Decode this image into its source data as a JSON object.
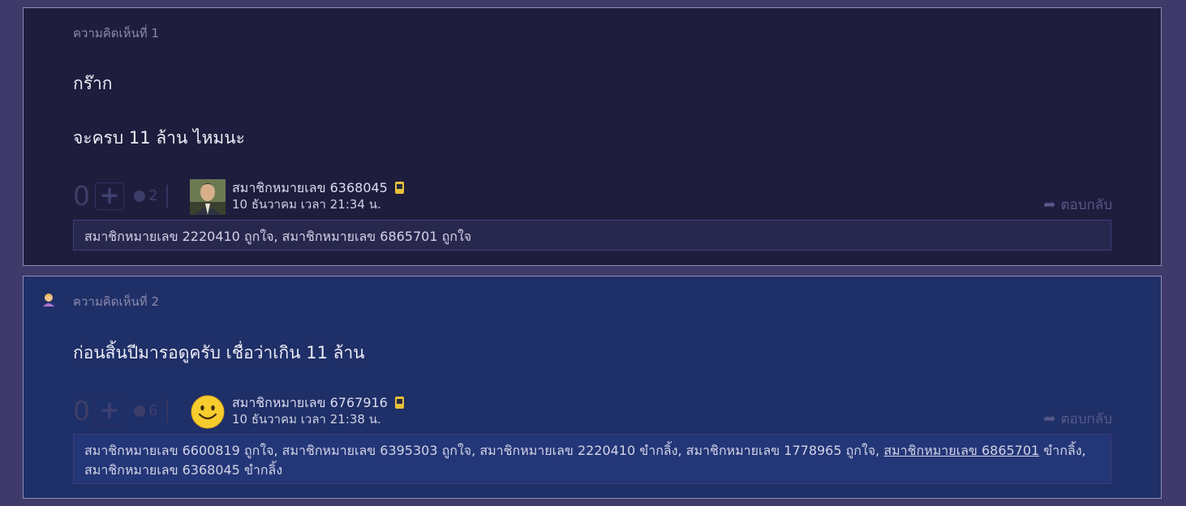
{
  "comments": [
    {
      "number_label": "ความคิดเห็นที่ 1",
      "lines": [
        "กร๊าก",
        "จะครบ 11 ล้าน ไหมนะ"
      ],
      "vote_count": "0",
      "emotion_count": "2",
      "username": "สมาชิกหมายเลข 6368045",
      "date": "10 ธันวาคม เวลา 21:34 น.",
      "reply_label": "ตอบกลับ",
      "likes": "สมาชิกหมายเลข 2220410 ถูกใจ, สมาชิกหมายเลข 6865701 ถูกใจ"
    },
    {
      "number_label": "ความคิดเห็นที่ 2",
      "lines": [
        "ก่อนสิ้นปีมารอดูครับ เชื่อว่าเกิน 11 ล้าน"
      ],
      "vote_count": "0",
      "emotion_count": "6",
      "username": "สมาชิกหมายเลข 6767916",
      "date": "10 ธันวาคม เวลา 21:38 น.",
      "reply_label": "ตอบกลับ",
      "likes_part1": "สมาชิกหมายเลข 6600819 ถูกใจ, สมาชิกหมายเลข 6395303 ถูกใจ, สมาชิกหมายเลข 2220410 ขำกลิ้ง, สมาชิกหมายเลข 1778965 ถูกใจ, ",
      "likes_link": "สมาชิกหมายเลข 6865701",
      "likes_part2": " ขำกลิ้ง,",
      "likes_line2": "สมาชิกหมายเลข 6368045 ขำกลิ้ง"
    }
  ],
  "icons": {
    "plus": "plus-icon",
    "emotion": "emotion-icon",
    "mobile": "mobile-icon",
    "reply": "reply-arrow-icon",
    "owner": "topic-owner-icon"
  },
  "colors": {
    "comment1_bg": "#1f1d3d",
    "comment2_bg": "#1f2f67",
    "page_bg": "#3f3a6a"
  }
}
